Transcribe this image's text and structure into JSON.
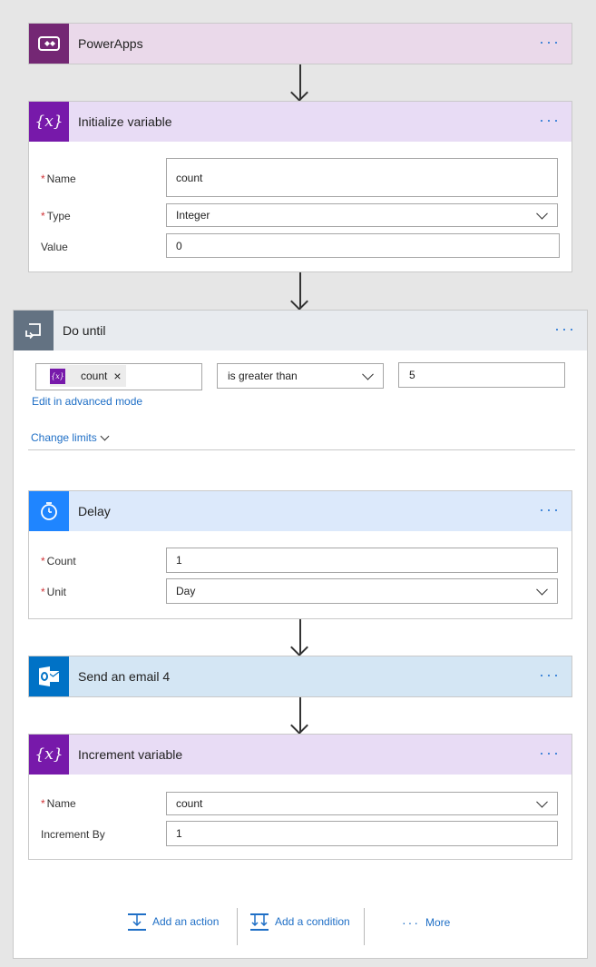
{
  "powerapps": {
    "title": "PowerApps",
    "icon": "powerapps-icon",
    "color": "#742774"
  },
  "init_variable": {
    "title": "Initialize variable",
    "icon": "variable-icon",
    "color": "#7719aa",
    "fields": {
      "name_label": "Name",
      "name_value": "count",
      "type_label": "Type",
      "type_value": "Integer",
      "value_label": "Value",
      "value_value": "0"
    }
  },
  "do_until": {
    "title": "Do until",
    "icon": "loop-icon",
    "condition": {
      "token": "count",
      "token_remove": "×",
      "operator": "is greater than",
      "value": "5"
    },
    "advanced_link": "Edit in advanced mode",
    "change_limits": "Change limits"
  },
  "delay": {
    "title": "Delay",
    "icon": "timer-icon",
    "color": "#1f85ff",
    "fields": {
      "count_label": "Count",
      "count_value": "1",
      "unit_label": "Unit",
      "unit_value": "Day"
    }
  },
  "send_email": {
    "title": "Send an email 4",
    "icon": "outlook-icon",
    "color": "#0072c6"
  },
  "increment_variable": {
    "title": "Increment variable",
    "icon": "variable-icon",
    "fields": {
      "name_label": "Name",
      "name_value": "count",
      "increment_label": "Increment By",
      "increment_value": "1"
    }
  },
  "actions": {
    "add_action": "Add an action",
    "add_condition": "Add a condition",
    "more": "More"
  },
  "common": {
    "required_marker": "*",
    "more_dots": "···"
  }
}
